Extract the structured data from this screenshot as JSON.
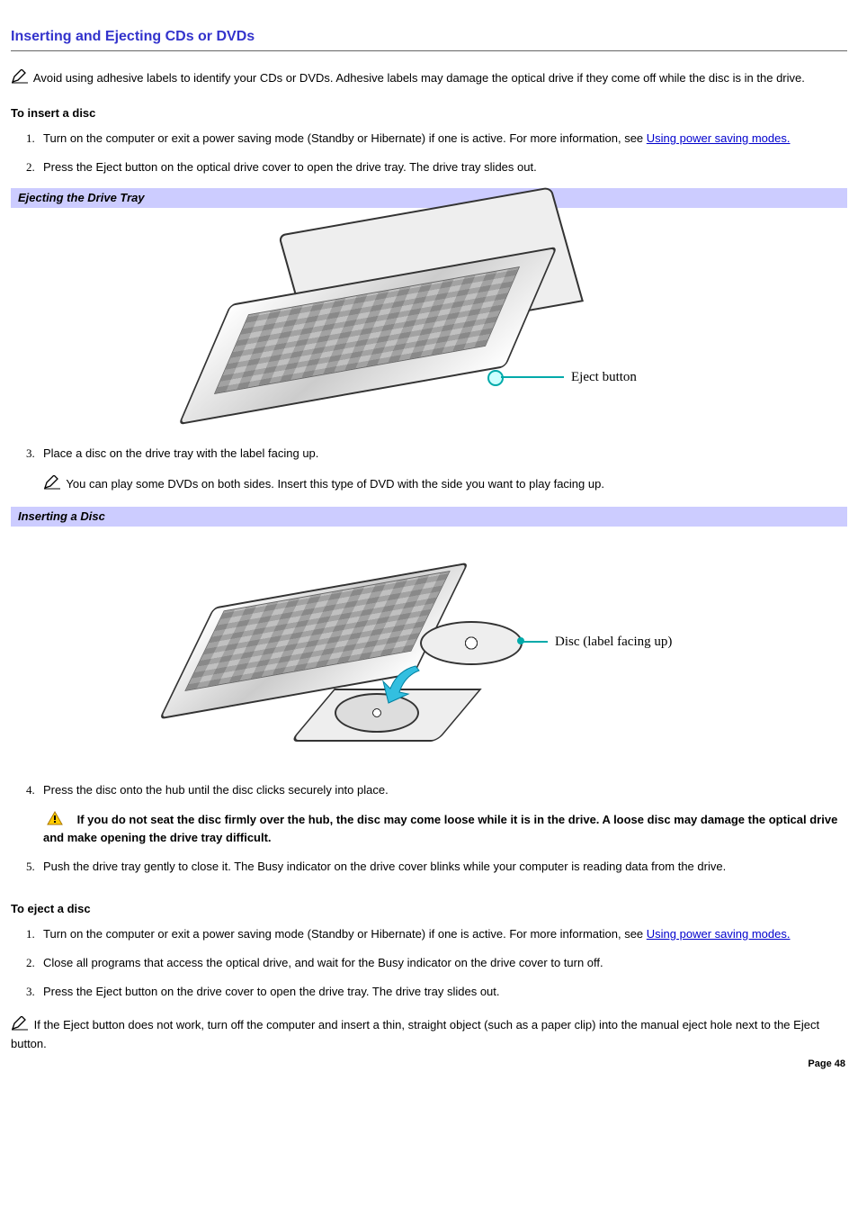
{
  "title": "Inserting and Ejecting CDs or DVDs",
  "intro_note": "Avoid using adhesive labels to identify your CDs or DVDs. Adhesive labels may damage the optical drive if they come off while the disc is in the drive.",
  "insert": {
    "heading": "To insert a disc",
    "step1_a": "Turn on the computer or exit a power saving mode (Standby or Hibernate) if one is active. For more information, see ",
    "step1_link": "Using power saving modes.",
    "step2": "Press the Eject button on the optical drive cover to open the drive tray. The drive tray slides out.",
    "fig1_caption": "Ejecting the Drive Tray",
    "fig1_label": "Eject button",
    "step3": "Place a disc on the drive tray with the label facing up.",
    "step3_note": "You can play some DVDs on both sides. Insert this type of DVD with the side you want to play facing up.",
    "fig2_caption": "Inserting a Disc",
    "fig2_label": "Disc (label facing up)",
    "step4": "Press the disc onto the hub until the disc clicks securely into place.",
    "step4_caution": "If you do not seat the disc firmly over the hub, the disc may come loose while it is in the drive. A loose disc may damage the optical drive and make opening the drive tray difficult.",
    "step5": "Push the drive tray gently to close it. The Busy indicator on the drive cover blinks while your computer is reading data from the drive."
  },
  "eject": {
    "heading": "To eject a disc",
    "step1_a": "Turn on the computer or exit a power saving mode (Standby or Hibernate) if one is active. For more information, see ",
    "step1_link": "Using power saving modes.",
    "step2": "Close all programs that access the optical drive, and wait for the Busy indicator on the drive cover to turn off.",
    "step3": "Press the Eject button on the drive cover to open the drive tray. The drive tray slides out."
  },
  "footer_note": "If the Eject button does not work, turn off the computer and insert a thin, straight object (such as a paper clip) into the manual eject hole next to the Eject button.",
  "page_num": "Page 48"
}
